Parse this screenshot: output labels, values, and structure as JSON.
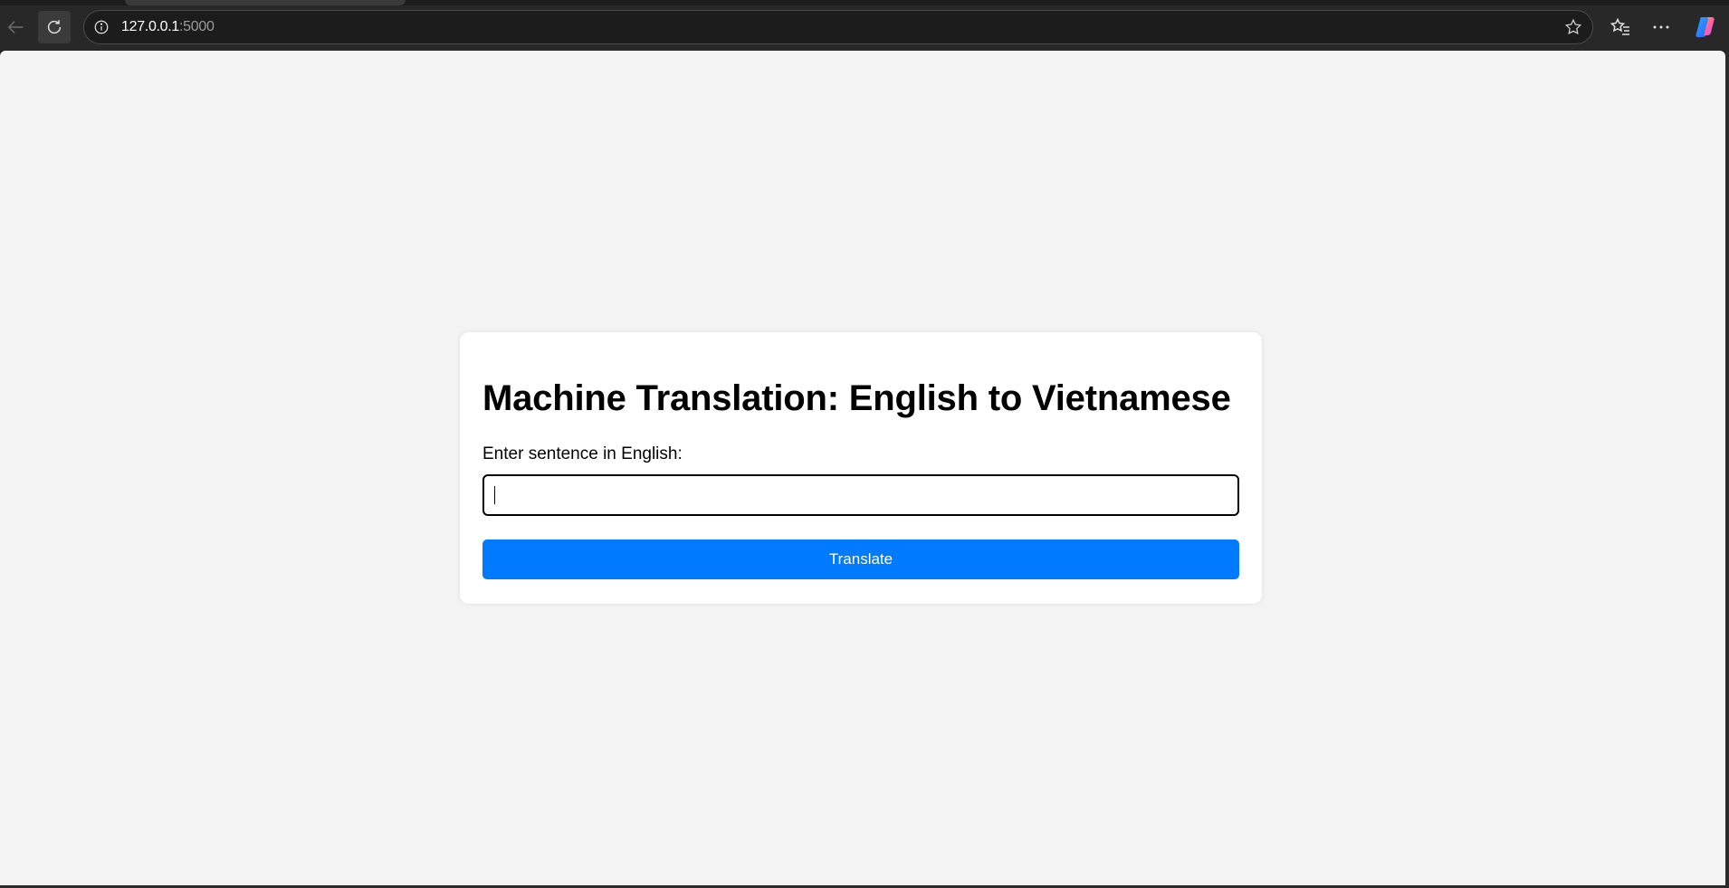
{
  "browser": {
    "url_host": "127.0.0.1",
    "url_port": ":5000",
    "icons": {
      "back": "arrow-left-icon",
      "reload": "reload-icon",
      "info": "info-icon",
      "favorite": "star-icon",
      "favorites": "favorites-list-icon",
      "more": "more-dots-icon",
      "copilot": "copilot-icon"
    }
  },
  "page": {
    "title": "Machine Translation: English to Vietnamese",
    "input_label": "Enter sentence in English:",
    "input_value": "",
    "input_placeholder": "",
    "translate_label": "Translate"
  },
  "colors": {
    "accent": "#007bff",
    "page_background": "#f3f3f3",
    "card_background": "#ffffff"
  }
}
